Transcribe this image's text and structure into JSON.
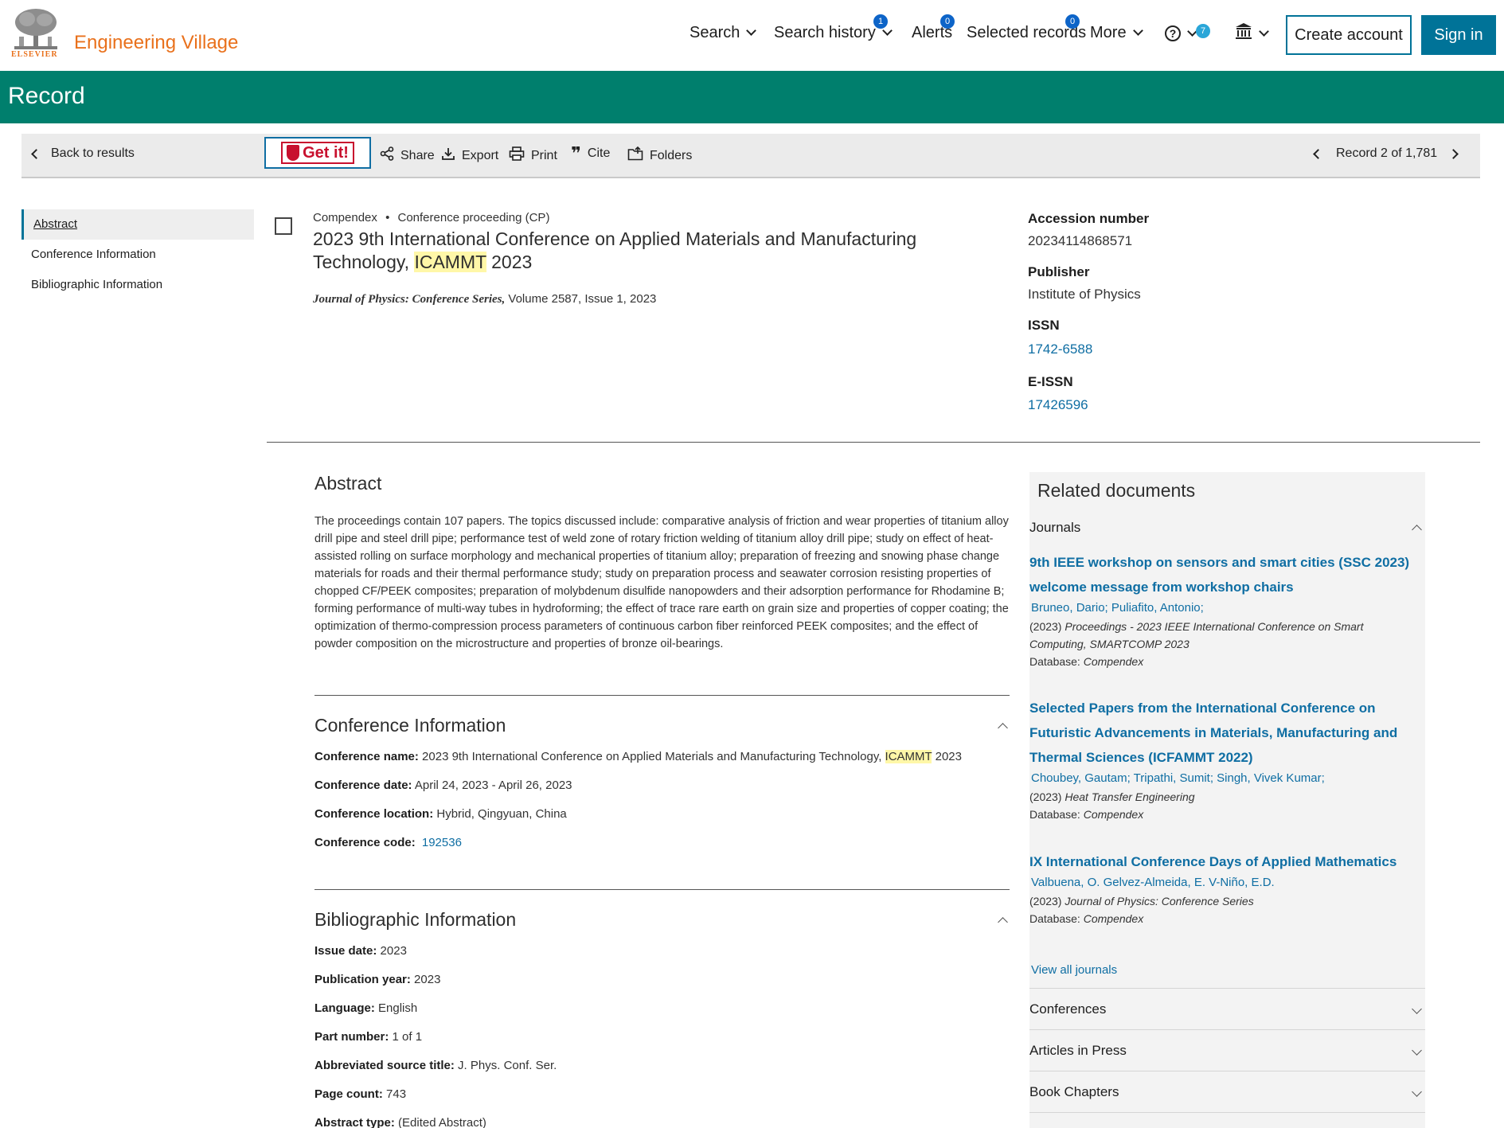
{
  "header": {
    "logo_word": "ELSEVIER",
    "brand": "Engineering Village",
    "nav": {
      "search": "Search",
      "search_history": "Search history",
      "search_history_badge": "1",
      "alerts": "Alerts",
      "alerts_badge": "0",
      "selected_records": "Selected records",
      "selected_badge": "0",
      "more": "More",
      "help_badge": "7",
      "help_icon": "question-circle-icon",
      "institution_icon": "institution-icon"
    },
    "create_account": "Create account",
    "sign_in": "Sign in"
  },
  "band": {
    "title": "Record"
  },
  "toolbar": {
    "back": "Back to results",
    "getit": "Get it!",
    "share": "Share",
    "export": "Export",
    "print": "Print",
    "cite": "Cite",
    "folders": "Folders",
    "record_position": "Record 2 of 1,781"
  },
  "leftnav": [
    "Abstract",
    "Conference Information",
    "Bibliographic Information"
  ],
  "record": {
    "database": "Compendex",
    "doc_type": "Conference proceeding (CP)",
    "title_part1": "2023 9th International Conference on Applied Materials and Manufacturing Technology,",
    "title_hl": "ICAMMT",
    "title_part2": " 2023",
    "source_journal": "Journal of Physics: Conference Series,",
    "source_rest": " Volume 2587, Issue 1, 2023"
  },
  "right_meta": {
    "accession_label": "Accession number",
    "accession_value": "20234114868571",
    "publisher_label": "Publisher",
    "publisher_value": "Institute of Physics",
    "issn_label": "ISSN",
    "issn_value": "1742-6588",
    "eissn_label": "E-ISSN",
    "eissn_value": "17426596"
  },
  "abstract": {
    "heading": "Abstract",
    "text": "The proceedings contain 107 papers. The topics discussed include: comparative analysis of friction and wear properties of titanium alloy drill pipe and steel drill pipe; performance test of weld zone of rotary friction welding of titanium alloy drill pipe; study on effect of heat-assisted rolling on surface morphology and mechanical properties of titanium alloy; preparation of freezing and snowing phase change materials for roads and their thermal performance study; study on preparation process and seawater corrosion resisting properties of chopped CF/PEEK composites; preparation of molybdenum disulfide nanopowders and their adsorption performance for Rhodamine B; forming performance of multi-way tubes in hydroforming; the effect of trace rare earth on grain size and properties of copper coating; the optimization of thermo-compression process parameters of continuous carbon fiber reinforced PEEK composites; and the effect of powder composition on the microstructure and properties of bronze oil-bearings."
  },
  "conference": {
    "heading": "Conference Information",
    "name_label": "Conference name:",
    "name_value": " 2023 9th International Conference on Applied Materials and Manufacturing Technology, ",
    "name_hl": "ICAMMT",
    "name_tail": " 2023",
    "date_label": "Conference date:",
    "date_value": " April 24, 2023 - April 26, 2023",
    "location_label": "Conference location:",
    "location_value": " Hybrid, Qingyuan, China",
    "code_label": "Conference code:",
    "code_value": "192536"
  },
  "biblio": {
    "heading": "Bibliographic Information",
    "rows": [
      {
        "label": "Issue date:",
        "value": " 2023"
      },
      {
        "label": "Publication year:",
        "value": " 2023"
      },
      {
        "label": "Language:",
        "value": " English"
      },
      {
        "label": "Part number:",
        "value": " 1 of 1"
      },
      {
        "label": "Abbreviated source title:",
        "value": " J. Phys. Conf. Ser."
      },
      {
        "label": "Page count:",
        "value": " 743"
      },
      {
        "label": "Abstract type:",
        "value": " (Edited Abstract)"
      }
    ]
  },
  "related": {
    "heading": "Related documents",
    "journals_label": "Journals",
    "items": [
      {
        "title": "9th IEEE workshop on sensors and smart cities (SSC 2023) welcome message from workshop chairs",
        "authors": "Bruneo, Dario; Puliafito, Antonio;",
        "year": "(2023)",
        "source": "Proceedings - 2023 IEEE International Conference on Smart Computing, SMARTCOMP 2023",
        "db_label": "Database:",
        "db": "Compendex"
      },
      {
        "title": "Selected Papers from the International Conference on Futuristic Advancements in Materials, Manufacturing and Thermal Sciences (ICFAMMT 2022)",
        "authors": "Choubey, Gautam; Tripathi, Sumit; Singh, Vivek Kumar;",
        "year": "(2023)",
        "source": "Heat Transfer Engineering",
        "db_label": "Database:",
        "db": "Compendex"
      },
      {
        "title": "IX International Conference Days of Applied Mathematics",
        "authors": "Valbuena, O. Gelvez-Almeida, E. V-Niño, E.D.",
        "year": "(2023)",
        "source": "Journal of Physics: Conference Series",
        "db_label": "Database:",
        "db": "Compendex"
      }
    ],
    "view_all": "View all journals",
    "accordions": [
      "Conferences",
      "Articles in Press",
      "Book Chapters"
    ]
  },
  "colors": {
    "brand_orange": "#e9711c",
    "teal_band": "#007f6d",
    "primary_blue": "#007398",
    "link_blue": "#0f6ea3",
    "highlight": "#fff7a8"
  }
}
